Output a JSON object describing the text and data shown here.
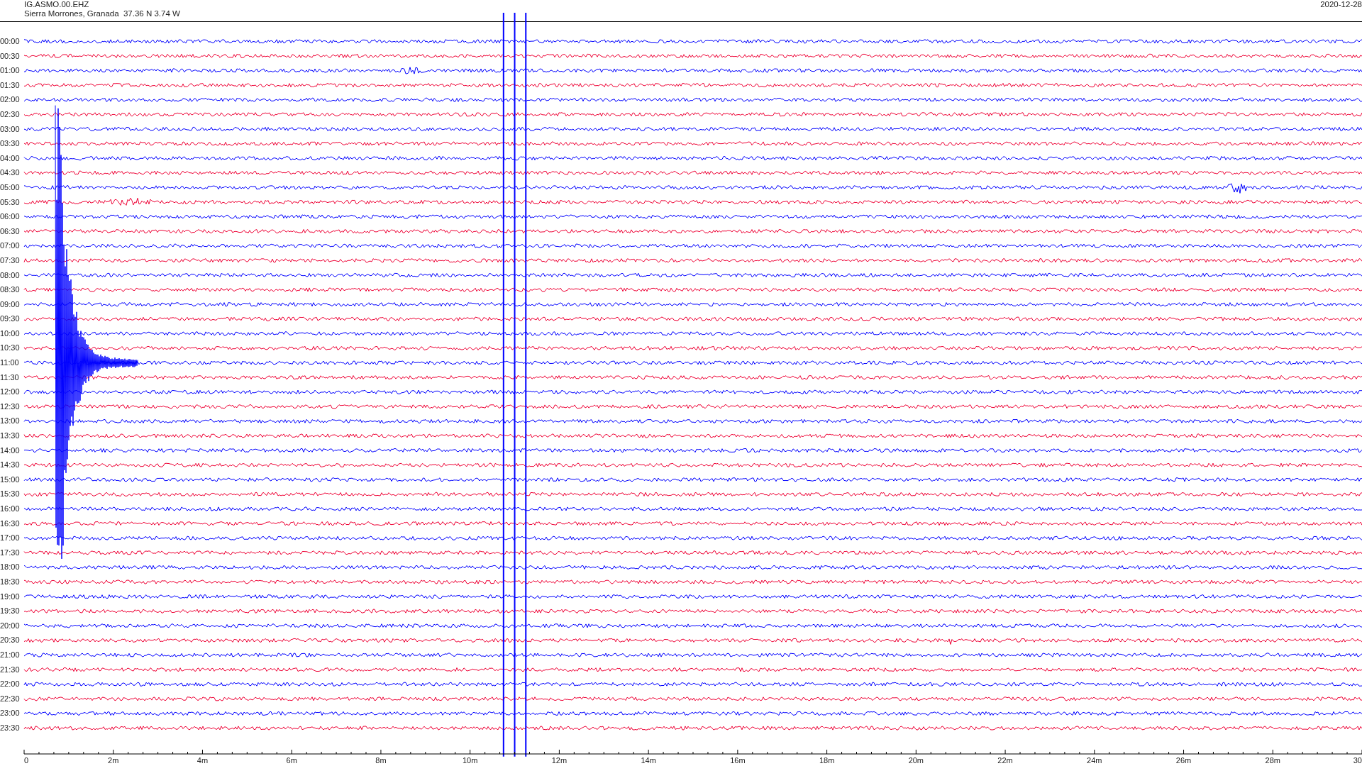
{
  "header": {
    "station": "IG.ASMO.00.EHZ",
    "location": "Sierra Morrones, Granada  37.36 N 3.74 W",
    "date": "2020-12-28"
  },
  "rows": [
    {
      "label": "00:00",
      "color": "#0000ff"
    },
    {
      "label": "00:30",
      "color": "#ee0033"
    },
    {
      "label": "01:00",
      "color": "#0000ff"
    },
    {
      "label": "01:30",
      "color": "#ee0033"
    },
    {
      "label": "02:00",
      "color": "#0000ff"
    },
    {
      "label": "02:30",
      "color": "#ee0033"
    },
    {
      "label": "03:00",
      "color": "#0000ff"
    },
    {
      "label": "03:30",
      "color": "#ee0033"
    },
    {
      "label": "04:00",
      "color": "#0000ff"
    },
    {
      "label": "04:30",
      "color": "#ee0033"
    },
    {
      "label": "05:00",
      "color": "#0000ff"
    },
    {
      "label": "05:30",
      "color": "#ee0033"
    },
    {
      "label": "06:00",
      "color": "#0000ff"
    },
    {
      "label": "06:30",
      "color": "#ee0033"
    },
    {
      "label": "07:00",
      "color": "#0000ff"
    },
    {
      "label": "07:30",
      "color": "#ee0033"
    },
    {
      "label": "08:00",
      "color": "#0000ff"
    },
    {
      "label": "08:30",
      "color": "#ee0033"
    },
    {
      "label": "09:00",
      "color": "#0000ff"
    },
    {
      "label": "09:30",
      "color": "#ee0033"
    },
    {
      "label": "10:00",
      "color": "#0000ff"
    },
    {
      "label": "10:30",
      "color": "#ee0033"
    },
    {
      "label": "11:00",
      "color": "#0000ff"
    },
    {
      "label": "11:30",
      "color": "#ee0033"
    },
    {
      "label": "12:00",
      "color": "#0000ff"
    },
    {
      "label": "12:30",
      "color": "#ee0033"
    },
    {
      "label": "13:00",
      "color": "#0000ff"
    },
    {
      "label": "13:30",
      "color": "#ee0033"
    },
    {
      "label": "14:00",
      "color": "#0000ff"
    },
    {
      "label": "14:30",
      "color": "#ee0033"
    },
    {
      "label": "15:00",
      "color": "#0000ff"
    },
    {
      "label": "15:30",
      "color": "#ee0033"
    },
    {
      "label": "16:00",
      "color": "#0000ff"
    },
    {
      "label": "16:30",
      "color": "#ee0033"
    },
    {
      "label": "17:00",
      "color": "#0000ff"
    },
    {
      "label": "17:30",
      "color": "#ee0033"
    },
    {
      "label": "18:00",
      "color": "#0000ff"
    },
    {
      "label": "18:30",
      "color": "#ee0033"
    },
    {
      "label": "19:00",
      "color": "#0000ff"
    },
    {
      "label": "19:30",
      "color": "#ee0033"
    },
    {
      "label": "20:00",
      "color": "#0000ff"
    },
    {
      "label": "20:30",
      "color": "#ee0033"
    },
    {
      "label": "21:00",
      "color": "#0000ff"
    },
    {
      "label": "21:30",
      "color": "#ee0033"
    },
    {
      "label": "22:00",
      "color": "#0000ff"
    },
    {
      "label": "22:30",
      "color": "#ee0033"
    },
    {
      "label": "23:00",
      "color": "#0000ff"
    },
    {
      "label": "23:30",
      "color": "#ee0033"
    }
  ],
  "x_axis": {
    "labels": [
      "0",
      "2m",
      "4m",
      "6m",
      "8m",
      "10m",
      "12m",
      "14m",
      "16m",
      "18m",
      "20m",
      "22m",
      "24m",
      "26m",
      "28m",
      "30"
    ]
  }
}
